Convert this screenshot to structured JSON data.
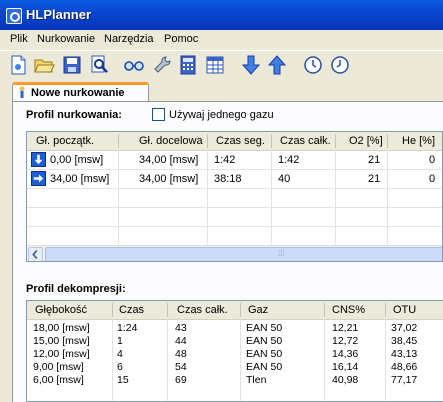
{
  "window": {
    "title": "HLPlanner"
  },
  "menu": [
    "Plik",
    "Nurkowanie",
    "Narzędzia",
    "Pomoc"
  ],
  "toolbar": {
    "icons": [
      "new-document-icon",
      "open-folder-icon",
      "save-icon",
      "print-preview-icon",
      "glasses-icon",
      "wrench-icon",
      "calculator-icon",
      "table-icon",
      "arrow-down-icon",
      "arrow-up-icon",
      "clock-icon",
      "clock-icon"
    ]
  },
  "tab": {
    "label": "Nowe nurkowanie"
  },
  "profile": {
    "title": "Profil nurkowania:",
    "single_gas_label": "Używaj jednego gazu",
    "columns": [
      "Gł. początk.",
      "Gł. docelowa",
      "Czas seg.",
      "Czas całk.",
      "O2 [%]",
      "He [%]"
    ],
    "rows": [
      {
        "direction": "down",
        "start": "0,00 [msw]",
        "target": "34,00 [msw]",
        "seg": "1:42",
        "total": "1:42",
        "o2": "21",
        "he": "0"
      },
      {
        "direction": "right",
        "start": "34,00 [msw]",
        "target": "34,00 [msw]",
        "seg": "38:18",
        "total": "40",
        "o2": "21",
        "he": "0"
      }
    ],
    "scroll_glyph": "⁞⁞⁞"
  },
  "decompression": {
    "title": "Profil dekompresji:",
    "columns": [
      "Głębokość",
      "Czas",
      "Czas całk.",
      "Gaz",
      "CNS%",
      "OTU"
    ],
    "rows": [
      [
        "18,00 [msw]",
        "1:24",
        "43",
        "EAN 50",
        "12,21",
        "37,02"
      ],
      [
        "15,00 [msw]",
        "1",
        "44",
        "EAN 50",
        "12,72",
        "38,45"
      ],
      [
        "12,00 [msw]",
        "4",
        "48",
        "EAN 50",
        "14,36",
        "43,13"
      ],
      [
        "9,00 [msw]",
        "6",
        "54",
        "EAN 50",
        "16,14",
        "48,66"
      ],
      [
        "6,00 [msw]",
        "15",
        "69",
        "Tlen",
        "40,98",
        "77,17"
      ]
    ]
  }
}
